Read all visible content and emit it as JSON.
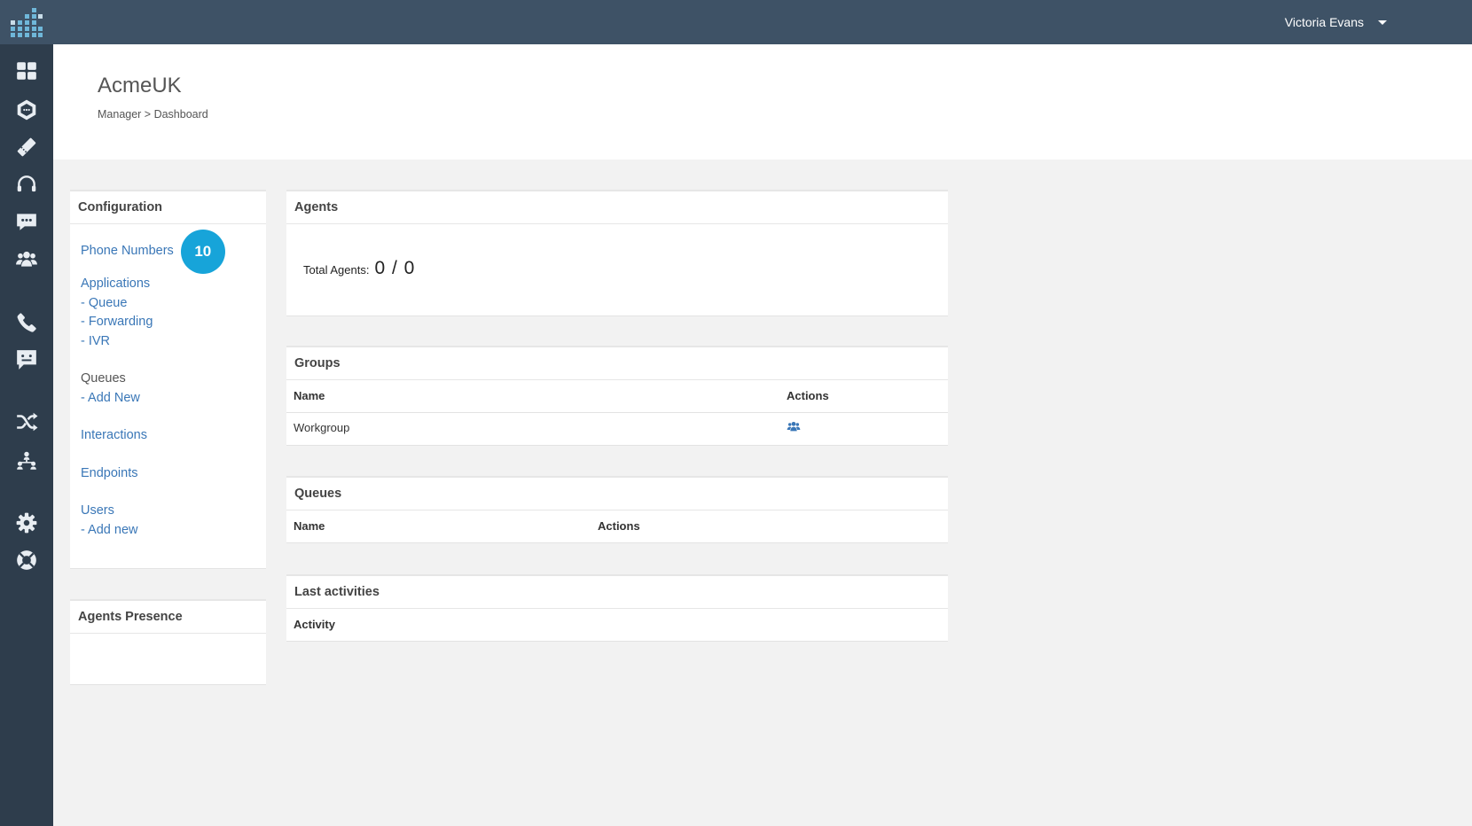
{
  "topbar": {
    "user_name": "Victoria Evans"
  },
  "sidebar": {
    "items": [
      {
        "icon": "dashboard-icon"
      },
      {
        "icon": "hexagon-chat-icon"
      },
      {
        "icon": "ticket-icon"
      },
      {
        "icon": "headset-icon"
      },
      {
        "icon": "chat-bubble-icon"
      },
      {
        "icon": "users-icon"
      },
      {
        "icon": "phone-icon"
      },
      {
        "icon": "message-icon"
      },
      {
        "icon": "shuffle-icon"
      },
      {
        "icon": "hierarchy-icon"
      },
      {
        "icon": "gear-icon"
      },
      {
        "icon": "lifebuoy-icon"
      }
    ]
  },
  "header": {
    "title": "AcmeUK",
    "breadcrumb": "Manager > Dashboard"
  },
  "configuration": {
    "title": "Configuration",
    "phone_numbers": "Phone Numbers",
    "phone_numbers_badge": "10",
    "applications": "Applications",
    "queue": "- Queue",
    "forwarding": "- Forwarding",
    "ivr": "- IVR",
    "queues": "Queues",
    "queues_add_new": "- Add New",
    "interactions": "Interactions",
    "endpoints": "Endpoints",
    "users": "Users",
    "users_add_new": "- Add new"
  },
  "agents_presence": {
    "title": "Agents Presence"
  },
  "agents": {
    "title": "Agents",
    "total_label": "Total Agents:",
    "total_value": "0 / 0"
  },
  "groups": {
    "title": "Groups",
    "columns": [
      "Name",
      "Actions"
    ],
    "rows": [
      {
        "name": "Workgroup",
        "action_icon": "users-icon"
      }
    ]
  },
  "queues": {
    "title": "Queues",
    "columns": [
      "Name",
      "Actions"
    ]
  },
  "last_activities": {
    "title": "Last activities",
    "columns": [
      "Activity"
    ]
  },
  "colors": {
    "topbar": "#3e5266",
    "sidebar": "#2e3d4c",
    "link": "#3a77b7",
    "badge": "#17a4d9"
  }
}
